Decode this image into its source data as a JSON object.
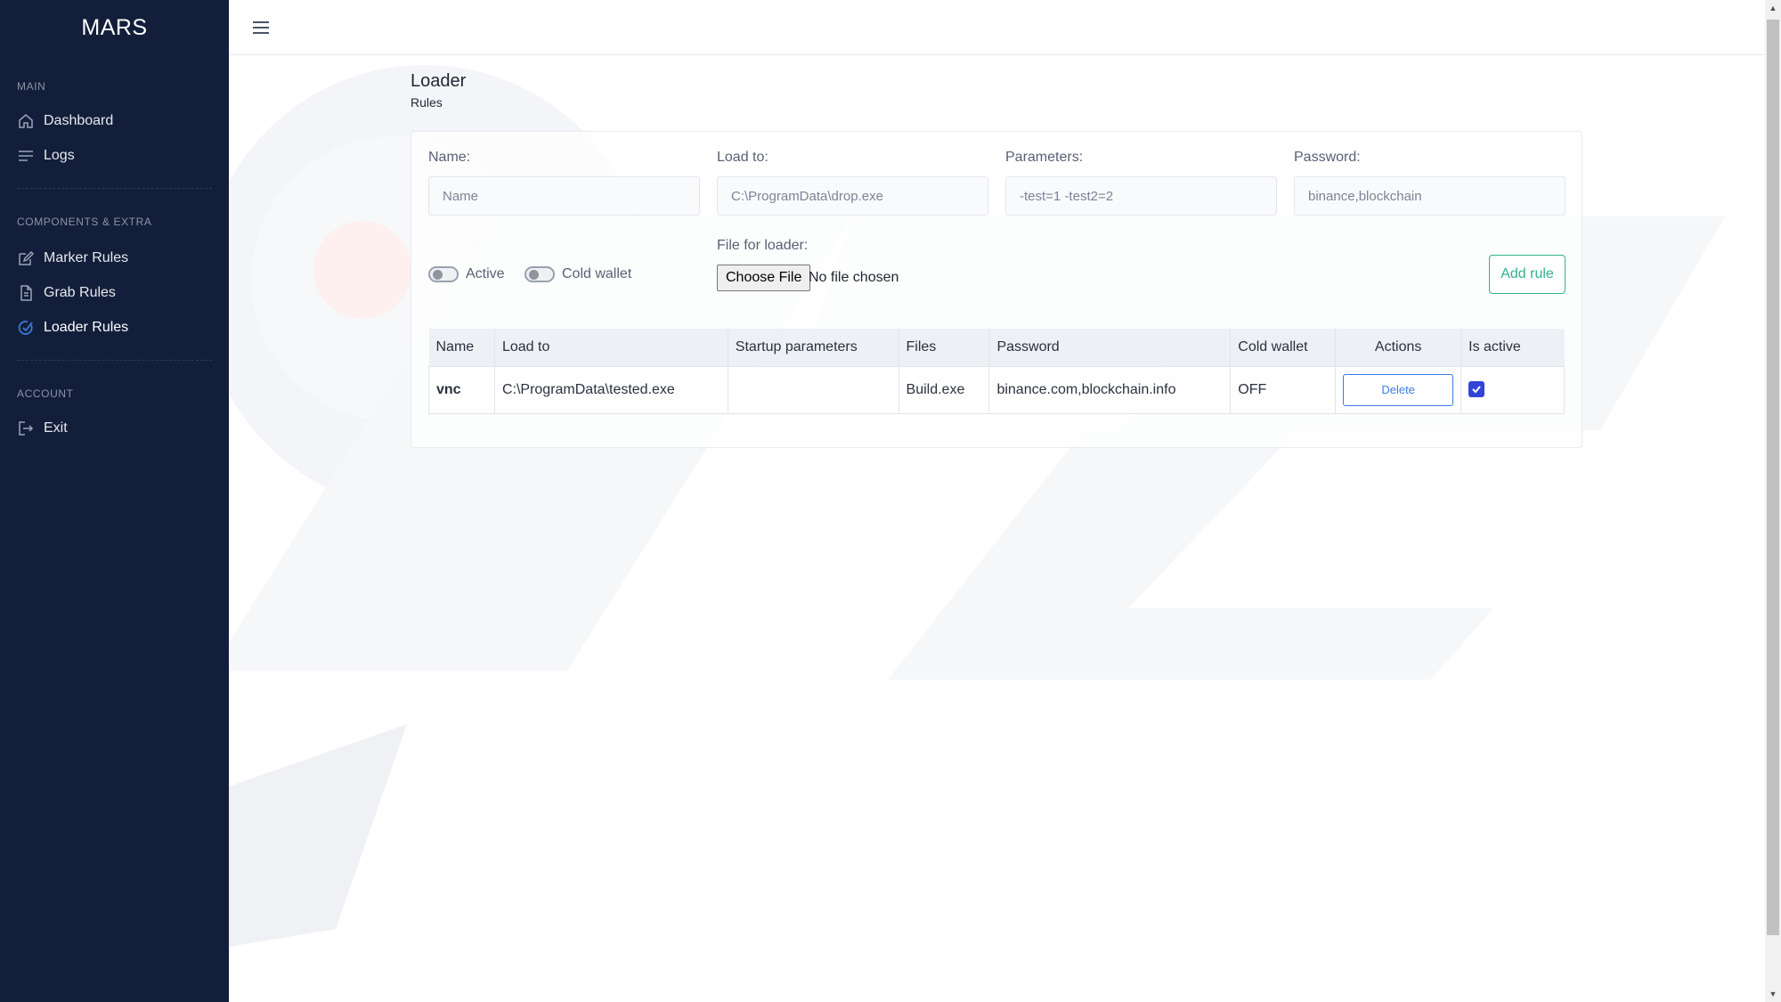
{
  "app": {
    "title": "MARS"
  },
  "sidebar": {
    "sections": [
      {
        "title": "MAIN",
        "items": [
          {
            "label": "Dashboard",
            "icon": "home-icon"
          },
          {
            "label": "Logs",
            "icon": "lines-icon"
          }
        ]
      },
      {
        "title": "COMPONENTS & EXTRA",
        "items": [
          {
            "label": "Marker Rules",
            "icon": "edit-icon"
          },
          {
            "label": "Grab Rules",
            "icon": "document-icon"
          },
          {
            "label": "Loader Rules",
            "icon": "check-circle-icon",
            "active": true
          }
        ]
      },
      {
        "title": "ACCOUNT",
        "items": [
          {
            "label": "Exit",
            "icon": "logout-icon"
          }
        ]
      }
    ]
  },
  "page": {
    "title": "Loader",
    "subtitle": "Rules"
  },
  "form": {
    "name": {
      "label": "Name:",
      "placeholder": "Name"
    },
    "load_to": {
      "label": "Load to:",
      "placeholder": "C:\\ProgramData\\drop.exe"
    },
    "parameters": {
      "label": "Parameters:",
      "placeholder": "-test=1 -test2=2"
    },
    "password": {
      "label": "Password:",
      "placeholder": "binance,blockchain"
    },
    "active_label": "Active",
    "cold_wallet_label": "Cold wallet",
    "file_label": "File for loader:",
    "file_button": "Choose File",
    "file_status": "No file chosen",
    "add_button": "Add rule"
  },
  "table": {
    "columns": [
      "Name",
      "Load to",
      "Startup parameters",
      "Files",
      "Password",
      "Cold wallet",
      "Actions",
      "Is active"
    ],
    "rows": [
      {
        "name": "vnc",
        "load_to": "C:\\ProgramData\\tested.exe",
        "startup_parameters": "",
        "files": "Build.exe",
        "password": "binance.com,blockchain.info",
        "cold_wallet": "OFF",
        "action": "Delete",
        "is_active": true
      }
    ]
  },
  "colors": {
    "sidebar_bg": "#131f3a",
    "accent_green": "#2fb38c",
    "accent_blue": "#3b7de0",
    "checkbox": "#3343d6"
  }
}
